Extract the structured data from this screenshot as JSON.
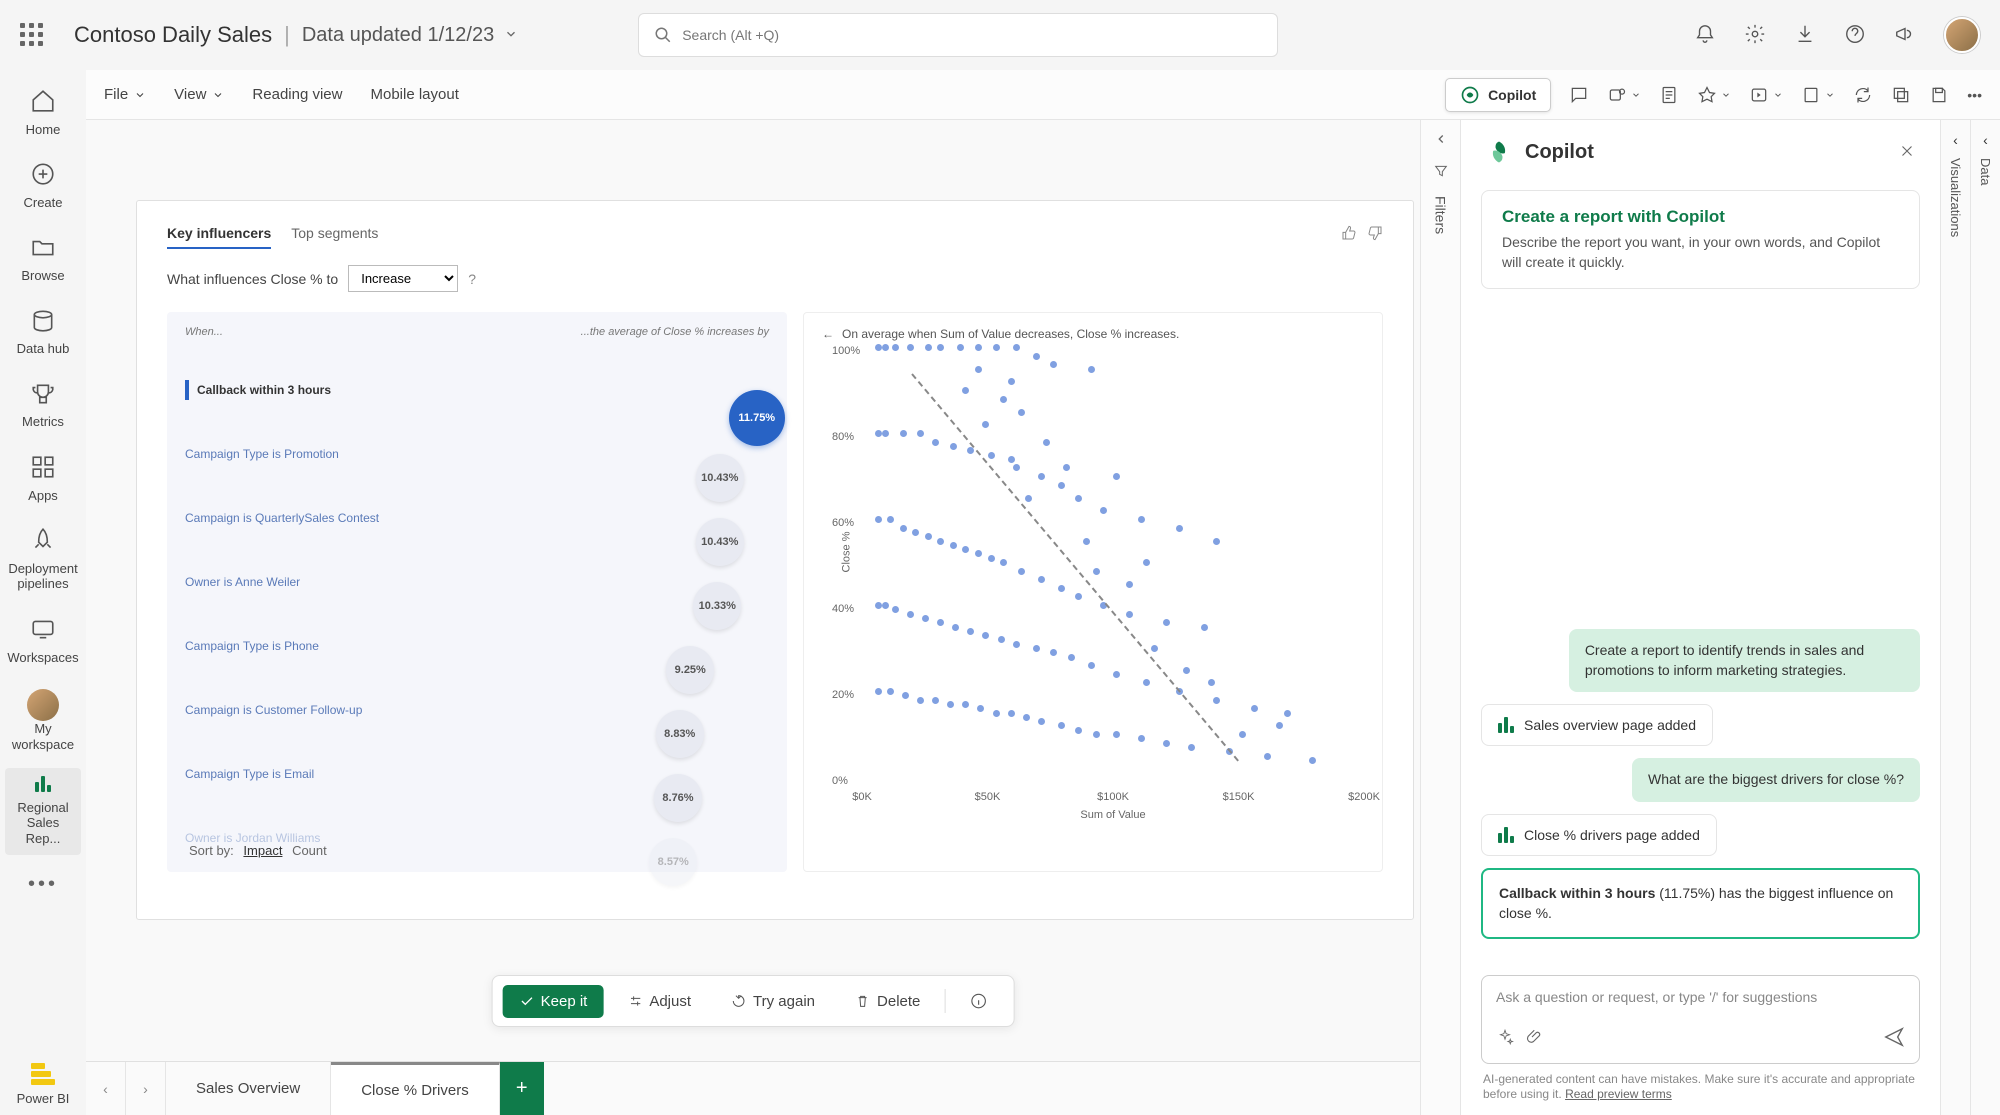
{
  "topbar": {
    "title": "Contoso Daily Sales",
    "subtitle": "Data updated 1/12/23",
    "search_placeholder": "Search (Alt +Q)"
  },
  "leftrail": {
    "items": [
      "Home",
      "Create",
      "Browse",
      "Data hub",
      "Metrics",
      "Apps",
      "Deployment pipelines",
      "Workspaces",
      "My workspace",
      "Regional Sales Rep..."
    ],
    "footer": "Power BI"
  },
  "toolbar2": {
    "file": "File",
    "view": "View",
    "reading": "Reading view",
    "mobile": "Mobile layout",
    "copilot": "Copilot"
  },
  "ki": {
    "tabs": [
      "Key influencers",
      "Top segments"
    ],
    "question_prefix": "What influences Close % to",
    "direction": "Increase",
    "head_when": "When...",
    "head_result": "...the average of Close % increases by",
    "sort_label": "Sort by:",
    "sort_options": [
      "Impact",
      "Count"
    ]
  },
  "scatter": {
    "title": "On average when Sum of Value decreases, Close % increases."
  },
  "chart_data": {
    "influencers": {
      "type": "bar",
      "items": [
        {
          "label": "Callback within 3 hours",
          "value": 11.75,
          "primary": true
        },
        {
          "label": "Campaign Type is Promotion",
          "value": 10.43
        },
        {
          "label": "Campaign is QuarterlySales Contest",
          "value": 10.43
        },
        {
          "label": "Owner is Anne Weiler",
          "value": 10.33
        },
        {
          "label": "Campaign Type is Phone",
          "value": 9.25
        },
        {
          "label": "Campaign is Customer Follow-up",
          "value": 8.83
        },
        {
          "label": "Campaign Type is Email",
          "value": 8.76
        },
        {
          "label": "Owner is Jordan Williams",
          "value": 8.57
        }
      ],
      "xlim": [
        0,
        12
      ]
    },
    "scatter": {
      "type": "scatter",
      "xlabel": "Sum of Value",
      "ylabel": "Close %",
      "xticks": [
        "$0K",
        "$50K",
        "$100K",
        "$150K",
        "$200K"
      ],
      "yticks": [
        "0%",
        "20%",
        "40%",
        "60%",
        "80%",
        "100%"
      ],
      "xlim": [
        0,
        200
      ],
      "ylim": [
        0,
        100
      ],
      "trend": {
        "x1": 20,
        "y1": 95,
        "x2": 150,
        "y2": 5
      },
      "points": [
        [
          5,
          100
        ],
        [
          8,
          100
        ],
        [
          12,
          100
        ],
        [
          18,
          100
        ],
        [
          25,
          100
        ],
        [
          30,
          100
        ],
        [
          38,
          100
        ],
        [
          45,
          100
        ],
        [
          52,
          100
        ],
        [
          60,
          100
        ],
        [
          68,
          98
        ],
        [
          75,
          96
        ],
        [
          90,
          95
        ],
        [
          5,
          80
        ],
        [
          8,
          80
        ],
        [
          15,
          80
        ],
        [
          22,
          80
        ],
        [
          28,
          78
        ],
        [
          35,
          77
        ],
        [
          42,
          76
        ],
        [
          50,
          75
        ],
        [
          58,
          74
        ],
        [
          60,
          72
        ],
        [
          70,
          70
        ],
        [
          78,
          68
        ],
        [
          85,
          65
        ],
        [
          95,
          62
        ],
        [
          110,
          60
        ],
        [
          125,
          58
        ],
        [
          140,
          55
        ],
        [
          5,
          60
        ],
        [
          10,
          60
        ],
        [
          15,
          58
        ],
        [
          20,
          57
        ],
        [
          25,
          56
        ],
        [
          30,
          55
        ],
        [
          35,
          54
        ],
        [
          40,
          53
        ],
        [
          45,
          52
        ],
        [
          50,
          51
        ],
        [
          55,
          50
        ],
        [
          62,
          48
        ],
        [
          70,
          46
        ],
        [
          78,
          44
        ],
        [
          85,
          42
        ],
        [
          95,
          40
        ],
        [
          105,
          38
        ],
        [
          120,
          36
        ],
        [
          135,
          35
        ],
        [
          5,
          40
        ],
        [
          8,
          40
        ],
        [
          12,
          39
        ],
        [
          18,
          38
        ],
        [
          24,
          37
        ],
        [
          30,
          36
        ],
        [
          36,
          35
        ],
        [
          42,
          34
        ],
        [
          48,
          33
        ],
        [
          54,
          32
        ],
        [
          60,
          31
        ],
        [
          68,
          30
        ],
        [
          75,
          29
        ],
        [
          82,
          28
        ],
        [
          90,
          26
        ],
        [
          100,
          24
        ],
        [
          112,
          22
        ],
        [
          125,
          20
        ],
        [
          140,
          18
        ],
        [
          155,
          16
        ],
        [
          168,
          15
        ],
        [
          5,
          20
        ],
        [
          10,
          20
        ],
        [
          16,
          19
        ],
        [
          22,
          18
        ],
        [
          28,
          18
        ],
        [
          34,
          17
        ],
        [
          40,
          17
        ],
        [
          46,
          16
        ],
        [
          52,
          15
        ],
        [
          58,
          15
        ],
        [
          64,
          14
        ],
        [
          70,
          13
        ],
        [
          78,
          12
        ],
        [
          85,
          11
        ],
        [
          92,
          10
        ],
        [
          100,
          10
        ],
        [
          110,
          9
        ],
        [
          120,
          8
        ],
        [
          130,
          7
        ],
        [
          145,
          6
        ],
        [
          160,
          5
        ],
        [
          178,
          4
        ],
        [
          40,
          90
        ],
        [
          55,
          88
        ],
        [
          62,
          85
        ],
        [
          48,
          82
        ],
        [
          72,
          78
        ],
        [
          80,
          72
        ],
        [
          65,
          65
        ],
        [
          88,
          55
        ],
        [
          92,
          48
        ],
        [
          105,
          45
        ],
        [
          115,
          30
        ],
        [
          128,
          25
        ],
        [
          138,
          22
        ],
        [
          100,
          70
        ],
        [
          112,
          50
        ],
        [
          58,
          92
        ],
        [
          45,
          95
        ],
        [
          150,
          10
        ],
        [
          165,
          12
        ]
      ]
    }
  },
  "actionbar": {
    "keep": "Keep it",
    "adjust": "Adjust",
    "try": "Try again",
    "delete": "Delete"
  },
  "sheets": {
    "tabs": [
      "Sales Overview",
      "Close % Drivers"
    ]
  },
  "filters": {
    "label": "Filters"
  },
  "copilot": {
    "title": "Copilot",
    "hero_title": "Create a report with Copilot",
    "hero_text": "Describe the report you want, in your own words, and Copilot will create it quickly.",
    "msg1": "Create a report to identify trends in sales and promotions to inform marketing strategies.",
    "bot1": "Sales overview page added",
    "msg2": "What are the biggest drivers for close %?",
    "bot2": "Close % drivers page added",
    "highlight_bold": "Callback within 3 hours",
    "highlight_pct": "(11.75%)",
    "highlight_rest": " has the biggest influence on close %.",
    "input_placeholder": "Ask a question or request, or type '/' for suggestions",
    "disclaimer_text": "AI-generated content can have mistakes. Make sure it's accurate and appropriate before using it. ",
    "disclaimer_link": "Read preview terms"
  },
  "right_panes": [
    "Visualizations",
    "Data"
  ]
}
